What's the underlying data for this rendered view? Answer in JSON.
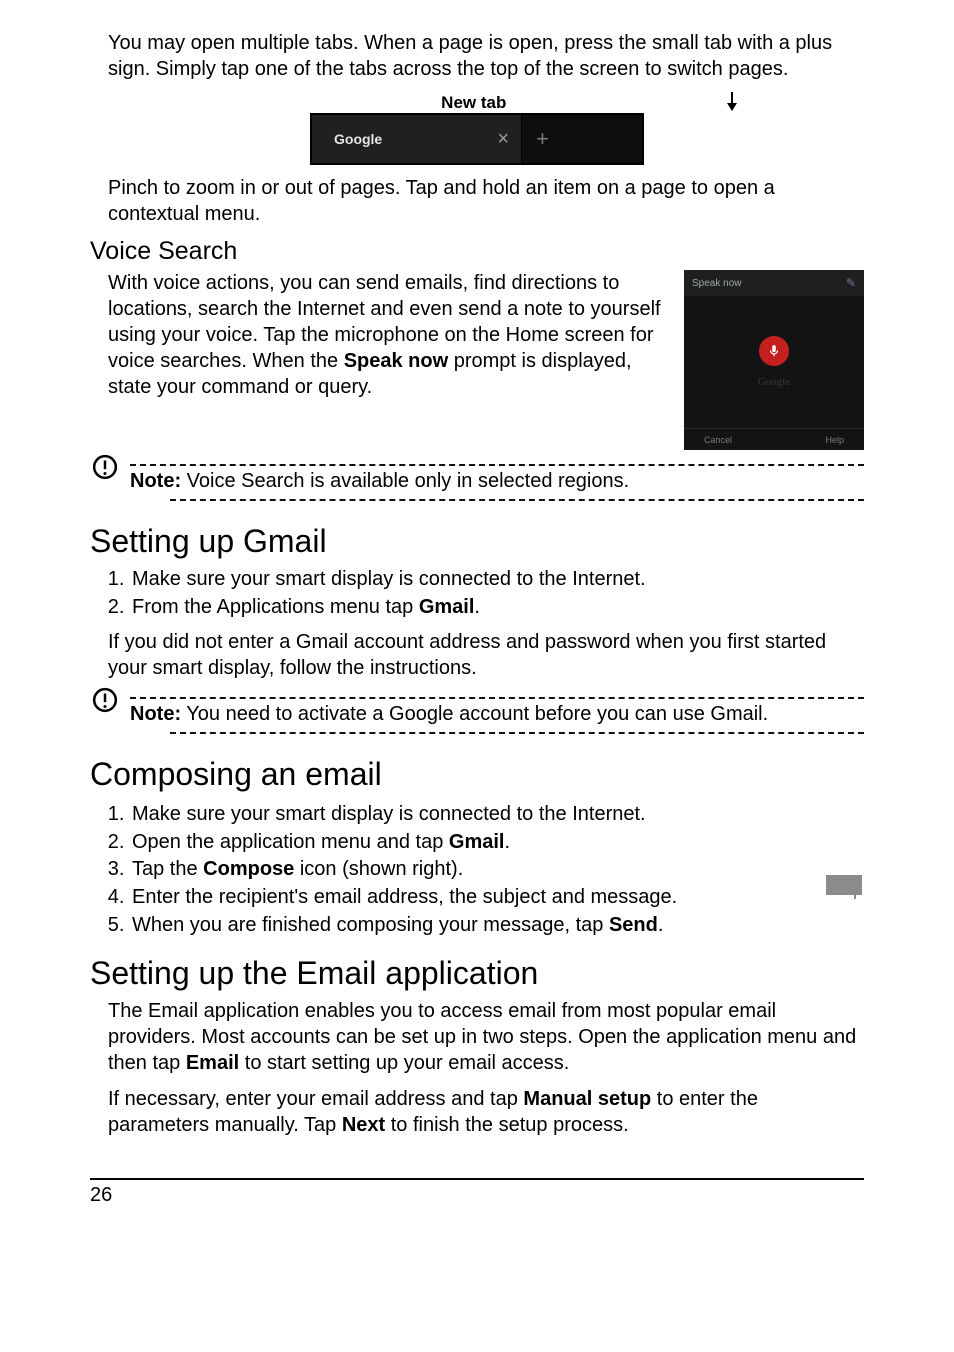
{
  "para_tabs": "You may open multiple tabs. When a page is open, press the small tab with a plus sign. Simply tap one of the tabs across the top of the screen to switch pages.",
  "fig_newtab": {
    "label": "New tab",
    "tab_title": "Google"
  },
  "para_pinch": "Pinch to zoom in or out of pages. Tap and hold an item on a page to open a contextual menu.",
  "h_voice": "Voice Search",
  "para_voice_pre": "With voice actions, you can send emails, find directions to locations, search the Internet and even send a note to yourself using your voice. Tap the microphone on the Home screen for voice searches. When the ",
  "para_voice_bold": "Speak now",
  "para_voice_post": " prompt is displayed, state your command or query.",
  "fig_voice": {
    "top": "Speak now",
    "brand": "Google",
    "cancel": "Cancel",
    "help": "Help"
  },
  "note_voice_b": "Note:",
  "note_voice_t": " Voice Search is available only in selected regions.",
  "h_gmail": "Setting up Gmail",
  "gmail_li1": "Make sure your smart display is connected to the Internet.",
  "gmail_li2_pre": "From the Applications menu tap ",
  "gmail_li2_b": "Gmail",
  "gmail_li2_post": ".",
  "para_gmail_follow": "If you did not enter a Gmail account address and password when you first started your smart display, follow the instructions.",
  "note_gmail_b": "Note:",
  "note_gmail_t": " You need to activate a Google account before you can use Gmail.",
  "h_compose": "Composing an email",
  "compose_li1": "Make sure your smart display is connected to the Internet.",
  "compose_li2_pre": "Open the application menu and tap ",
  "compose_li2_b": "Gmail",
  "compose_li2_post": ".",
  "compose_li3_pre": "Tap the ",
  "compose_li3_b": "Compose",
  "compose_li3_post": " icon (shown right).",
  "compose_li4": "Enter the recipient's email address, the subject and message.",
  "compose_li5_pre": "When you are finished composing your message, tap ",
  "compose_li5_b": "Send",
  "compose_li5_post": ".",
  "h_emailapp": "Setting up the Email application",
  "para_emailapp_pre": "The Email application enables you to access email from most popular email providers. Most accounts can be set up in two steps. Open the application menu and then tap ",
  "para_emailapp_b": "Email",
  "para_emailapp_post": " to start setting up your email access.",
  "para_manual_1": "If necessary, enter your email address and tap ",
  "para_manual_b1": "Manual setup",
  "para_manual_2": " to enter the parameters manually. Tap ",
  "para_manual_b2": "Next",
  "para_manual_3": " to finish the setup process.",
  "page_number": "26"
}
